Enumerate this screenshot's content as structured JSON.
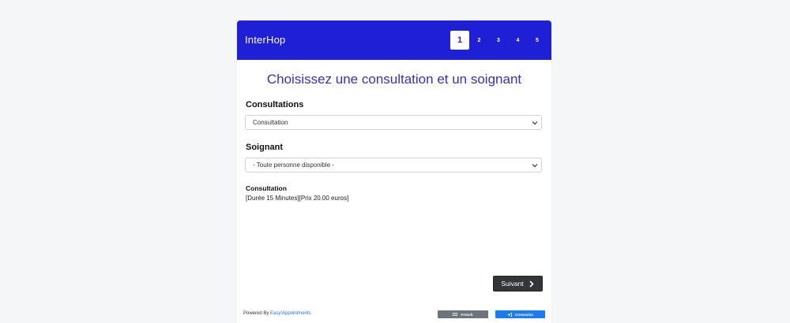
{
  "header": {
    "brand": "InterHop",
    "steps": [
      "1",
      "2",
      "3",
      "4",
      "5"
    ],
    "active_step": "1",
    "color": "#1f1fd6"
  },
  "main": {
    "title": "Choisissez une consultation et un soignant",
    "consultations": {
      "label": "Consultations",
      "selected": "Consultation"
    },
    "soignant": {
      "label": "Soignant",
      "selected": "- Toute personne disponible -"
    },
    "info": {
      "title": "Consultation",
      "detail": "[Durée 15 Minutes][Prix 20.00 euros]"
    },
    "next_label": "Suivant"
  },
  "footer": {
    "powered_by": "Powered By ",
    "powered_link": "Easy!Appointments",
    "language_label": "French",
    "login_label": "Connexion"
  }
}
